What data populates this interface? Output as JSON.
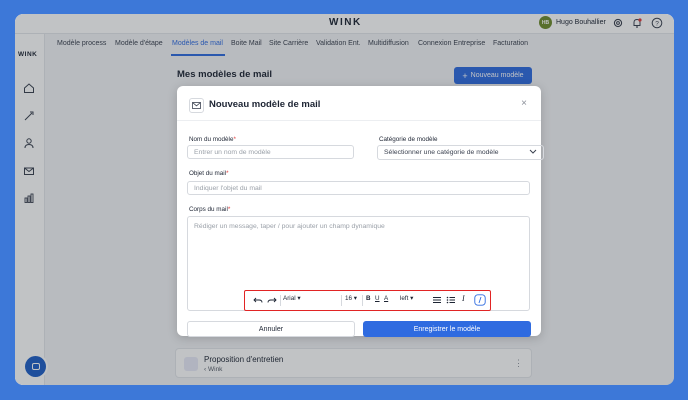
{
  "app": {
    "brand": "WINK"
  },
  "user": {
    "initials": "HB",
    "name": "Hugo Bouhallier"
  },
  "nav": {
    "items": [
      {
        "label": "Modèle process"
      },
      {
        "label": "Modèle d'étape"
      },
      {
        "label": "Modèles de mail"
      },
      {
        "label": "Boite Mail"
      },
      {
        "label": "Site Carrière"
      },
      {
        "label": "Validation Ent."
      },
      {
        "label": "Multidiffusion"
      },
      {
        "label": "Connexion Entreprise"
      },
      {
        "label": "Facturation"
      }
    ],
    "active_index": 2
  },
  "page": {
    "title": "Mes modèles de mail",
    "new_button_label": "Nouveau modèle"
  },
  "list": {
    "card": {
      "title": "Proposition d'entretien",
      "subtitle": "Wink"
    }
  },
  "modal": {
    "title": "Nouveau modèle de mail",
    "close_icon": "close-icon",
    "fields": {
      "name": {
        "label": "Nom du modèle",
        "required_mark": "*",
        "placeholder": "Entrer un nom de modèle"
      },
      "category": {
        "label": "Catégorie de modèle",
        "value": "Sélectionner une catégorie de modèle"
      },
      "subject": {
        "label": "Objet du mail",
        "required_mark": "*",
        "placeholder": "Indiquer l'objet du mail"
      },
      "body": {
        "label": "Corps du mail",
        "required_mark": "*",
        "placeholder": "Rédiger un message, taper / pour ajouter un champ dynamique"
      }
    },
    "toolbar": {
      "font": "Arial",
      "size": "16",
      "bold": "B",
      "underline": "U",
      "color": "A",
      "align": "left",
      "italic": "I",
      "highlight_color": "#e12424"
    },
    "buttons": {
      "cancel": "Annuler",
      "save": "Enregistrer le modèle"
    }
  },
  "colors": {
    "accent": "#2f6be0",
    "background": "#3d78d8"
  }
}
